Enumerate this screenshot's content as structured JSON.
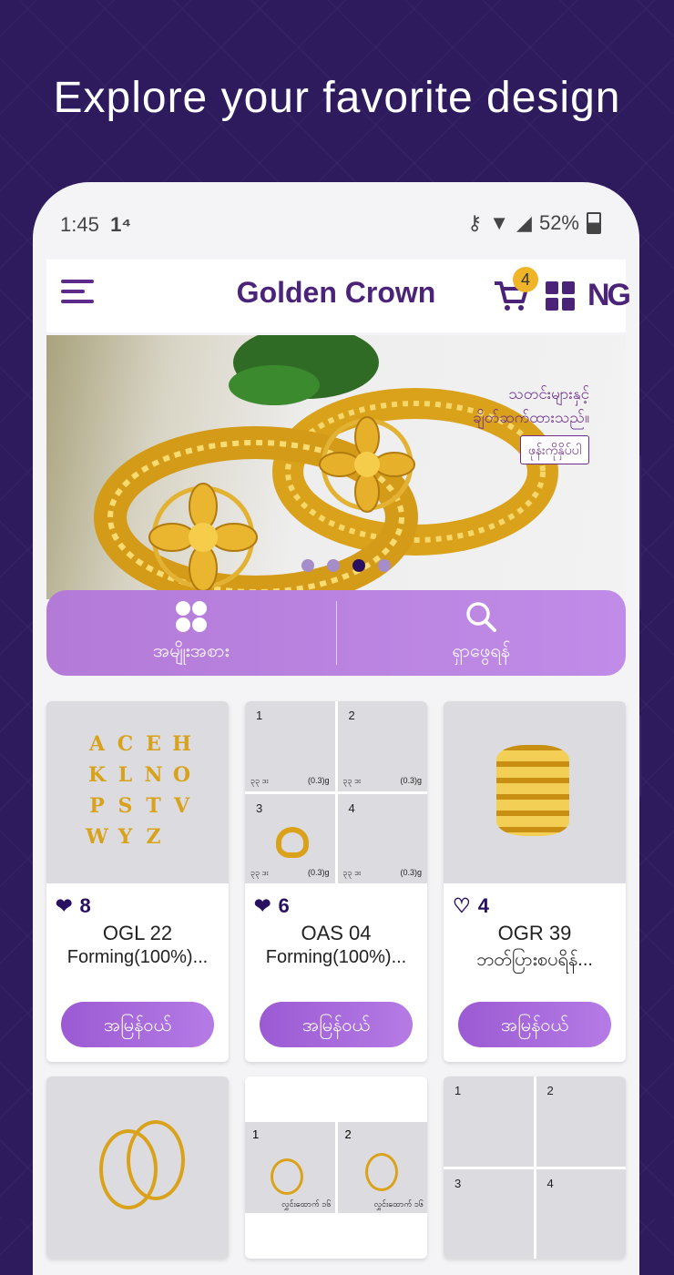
{
  "headline": "Explore your favorite design",
  "status_bar": {
    "time": "1:45",
    "battery": "52%"
  },
  "app_bar": {
    "title": "Golden Crown",
    "cart_count": "4",
    "logo_text": "NG"
  },
  "banner": {
    "text_line1": "သတင်းများနှင့်",
    "text_line2": "ချိတ်ဆက်ထားသည်။",
    "tag": "ဖုန်းကိုနှိပ်ပါ",
    "slide_count": 4,
    "active_slide": 3
  },
  "quick_actions": [
    {
      "label": "အမျိုးအစား",
      "icon": "category-grid-icon"
    },
    {
      "label": "ရှာဖွေရန်",
      "icon": "search-icon"
    }
  ],
  "products": [
    {
      "likes": "8",
      "liked": true,
      "code": "OGL 22",
      "desc": "Forming(100%)...",
      "button": "အမြန်ဝယ်"
    },
    {
      "likes": "6",
      "liked": true,
      "code": "OAS 04",
      "desc": "Forming(100%)...",
      "button": "အမြန်ဝယ်",
      "variants": [
        {
          "n": "1",
          "left": "၃၃ ဒး",
          "right": "(0.3)g"
        },
        {
          "n": "2",
          "left": "၃၃ ဒး",
          "right": "(0.3)g"
        },
        {
          "n": "3",
          "left": "၃၃ ဒး",
          "right": "(0.3)g"
        },
        {
          "n": "4",
          "left": "၃၃ ဒး",
          "right": "(0.3)g"
        }
      ]
    },
    {
      "likes": "4",
      "liked": false,
      "code": "OGR 39",
      "desc": "ဘတ်ပြားစပရိန်...",
      "button": "အမြန်ဝယ်"
    }
  ],
  "row2": {
    "middle_variants": [
      "1",
      "2"
    ],
    "middle_labels": [
      "လွှင်းထောက် ၁၆",
      "လွှင်းထောက် ၁၆"
    ],
    "right_variants": [
      "1",
      "2",
      "3",
      "4"
    ]
  },
  "letters": [
    "A",
    "C",
    "E",
    "H",
    "K",
    "L",
    "N",
    "O",
    "P",
    "S",
    "T",
    "V",
    "W",
    "Y",
    "Z"
  ],
  "colors": {
    "brand": "#4b2378",
    "background": "#2d1b5e",
    "accent": "#b47ad8",
    "badge": "#f0b429"
  }
}
